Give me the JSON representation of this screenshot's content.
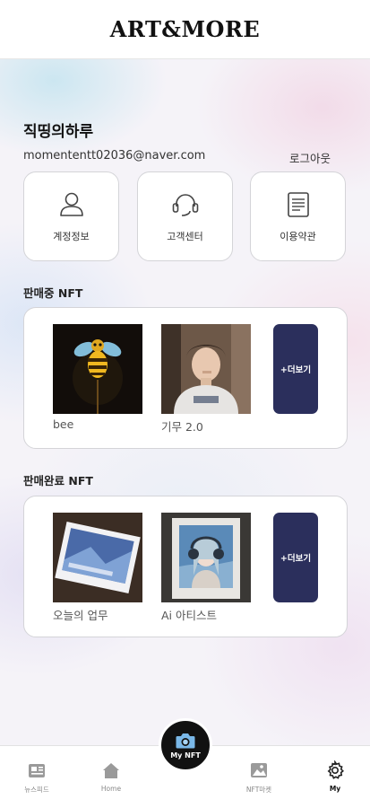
{
  "app": {
    "logo": "ART&MORE"
  },
  "profile": {
    "name": "직띵의하루",
    "email": "momententt02036@naver.com",
    "logout_label": "로그아웃"
  },
  "menu": [
    {
      "label": "계정정보",
      "icon": "person-icon"
    },
    {
      "label": "고객센터",
      "icon": "headset-icon"
    },
    {
      "label": "이용약관",
      "icon": "document-icon"
    }
  ],
  "selling": {
    "title": "판매중 NFT",
    "items": [
      {
        "name": "bee",
        "image": "bee-artwork"
      },
      {
        "name": "기무 2.0",
        "image": "man-portrait-photo"
      }
    ],
    "more_label": "+더보기"
  },
  "sold": {
    "title": "판매완료 NFT",
    "items": [
      {
        "name": "오늘의 업무",
        "image": "blue-card-artwork"
      },
      {
        "name": "Ai 아티스트",
        "image": "ai-girl-headphones"
      }
    ],
    "more_label": "+더보기"
  },
  "tabbar": {
    "tabs": [
      {
        "label": "뉴스피드",
        "icon": "newsfeed-icon"
      },
      {
        "label": "Home",
        "icon": "home-icon"
      },
      {
        "label": "My NFT",
        "icon": "camera-icon"
      },
      {
        "label": "NFT마켓",
        "icon": "gallery-icon"
      },
      {
        "label": "My",
        "icon": "gear-icon",
        "active": true
      }
    ]
  },
  "colors": {
    "accent_navy": "#2b2f5c",
    "center_tab": "#111111",
    "card_border": "#d4d4d8"
  }
}
